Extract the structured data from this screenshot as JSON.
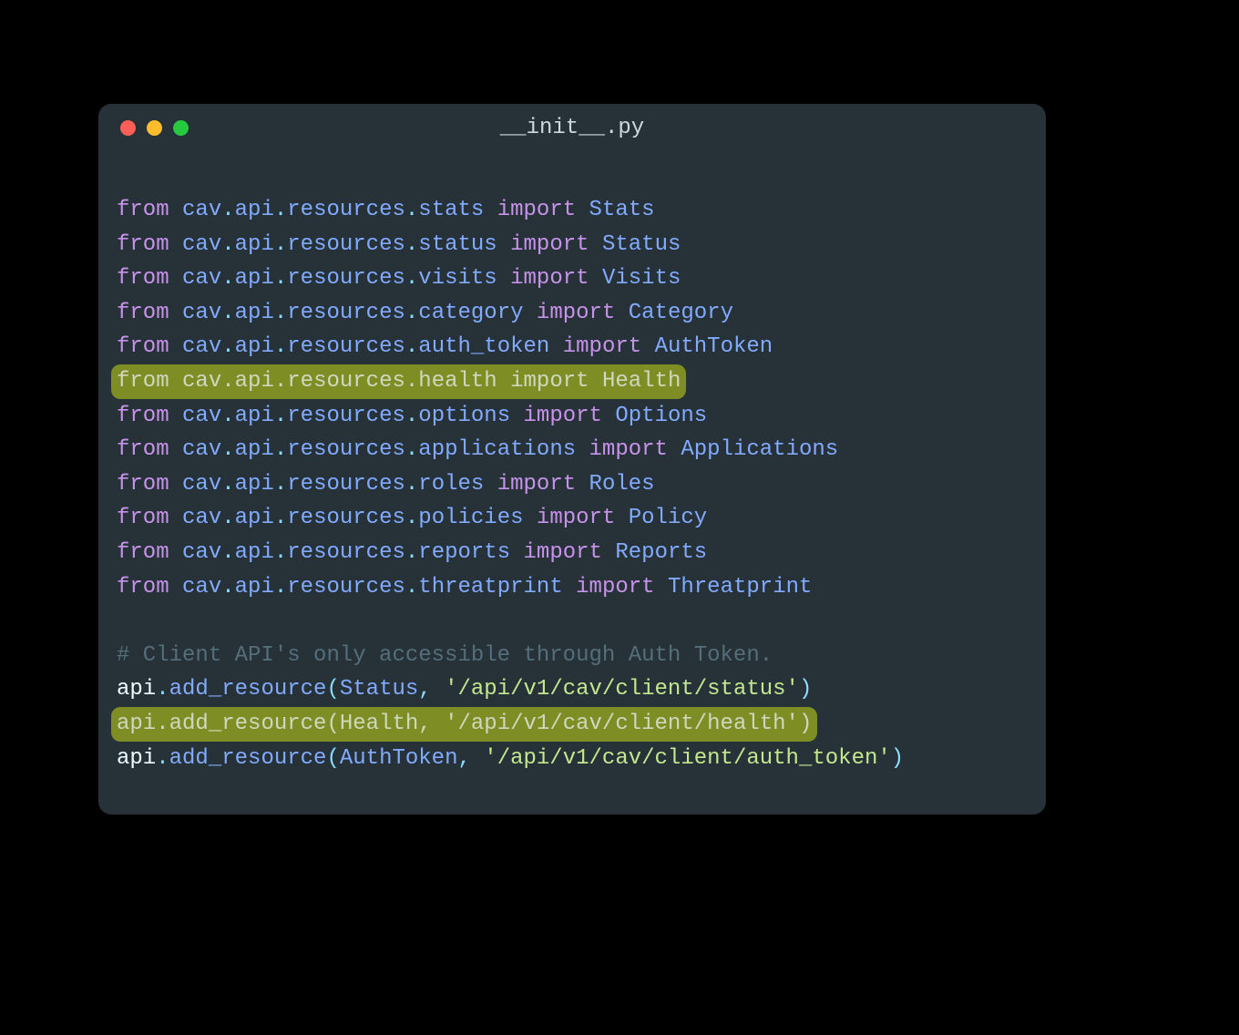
{
  "window": {
    "title": "__init__.py"
  },
  "imports": [
    {
      "path": "cav.api.resources.stats",
      "name": "Stats",
      "highlighted": false
    },
    {
      "path": "cav.api.resources.status",
      "name": "Status",
      "highlighted": false
    },
    {
      "path": "cav.api.resources.visits",
      "name": "Visits",
      "highlighted": false
    },
    {
      "path": "cav.api.resources.category",
      "name": "Category",
      "highlighted": false
    },
    {
      "path": "cav.api.resources.auth_token",
      "name": "AuthToken",
      "highlighted": false
    },
    {
      "path": "cav.api.resources.health",
      "name": "Health",
      "highlighted": true
    },
    {
      "path": "cav.api.resources.options",
      "name": "Options",
      "highlighted": false
    },
    {
      "path": "cav.api.resources.applications",
      "name": "Applications",
      "highlighted": false
    },
    {
      "path": "cav.api.resources.roles",
      "name": "Roles",
      "highlighted": false
    },
    {
      "path": "cav.api.resources.policies",
      "name": "Policy",
      "highlighted": false
    },
    {
      "path": "cav.api.resources.reports",
      "name": "Reports",
      "highlighted": false
    },
    {
      "path": "cav.api.resources.threatprint",
      "name": "Threatprint",
      "highlighted": false
    }
  ],
  "comment": "# Client API's only accessible through Auth Token.",
  "routes": [
    {
      "object": "api",
      "method": "add_resource",
      "resource": "Status",
      "url": "'/api/v1/cav/client/status'",
      "highlighted": false
    },
    {
      "object": "api",
      "method": "add_resource",
      "resource": "Health",
      "url": "'/api/v1/cav/client/health'",
      "highlighted": true
    },
    {
      "object": "api",
      "method": "add_resource",
      "resource": "AuthToken",
      "url": "'/api/v1/cav/client/auth_token'",
      "highlighted": false
    }
  ],
  "tokens": {
    "from": "from",
    "import": "import"
  }
}
